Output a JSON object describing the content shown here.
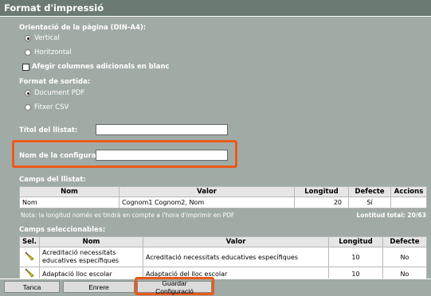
{
  "window": {
    "title": "Format d'impressió"
  },
  "orientation": {
    "heading": "Orientació de la pàgina (DIN-A4):",
    "options": [
      {
        "label": "Vertical",
        "selected": true
      },
      {
        "label": "Horitzontal",
        "selected": false
      }
    ],
    "extra_columns_label": "Afegir columnes adicionals en blanc",
    "extra_columns_checked": false
  },
  "output_format": {
    "heading": "Format de sortida:",
    "options": [
      {
        "label": "Document PDF",
        "selected": true
      },
      {
        "label": "Fitxer CSV",
        "selected": false
      }
    ]
  },
  "fields": {
    "title_label": "Títol del llistat:",
    "title_value": "",
    "config_name_label": "Nom de la configuració:",
    "config_name_value": ""
  },
  "list_fields": {
    "heading": "Camps del llistat:",
    "columns": [
      "Nom",
      "Valor",
      "Longitud",
      "Defecte",
      "Accions"
    ],
    "rows": [
      {
        "nom": "Nom",
        "valor": "Cognom1 Cognom2, Nom",
        "longitud": "20",
        "defecte": "Sí",
        "accions": ""
      }
    ],
    "note": "Nota: la longitud només es tindrà en compte a l'hora d'imprimir en PDF",
    "total": "Lontitud total: 20/63"
  },
  "selectable_fields": {
    "heading": "Camps seleccionables:",
    "columns": [
      "Sel.",
      "Nom",
      "Valor",
      "Longitud",
      "Defecte"
    ],
    "rows": [
      {
        "icon": "pencil-icon",
        "nom": "Acreditació necessitats educatives específiques",
        "valor": "Acreditació necessitats educatives específiques",
        "longitud": "10",
        "defecte": "No"
      },
      {
        "icon": "pencil-icon",
        "nom": "Adaptació lloc escolar",
        "valor": "Adaptació del lloc escolar",
        "longitud": "10",
        "defecte": "No"
      }
    ]
  },
  "buttons": {
    "close": "Tanca",
    "back": "Enrere",
    "save_config": "Guardar Configuració"
  },
  "colors": {
    "highlight": "#ea5a1a",
    "panel": "#a0aba6",
    "titlebar": "#6b7b74"
  }
}
